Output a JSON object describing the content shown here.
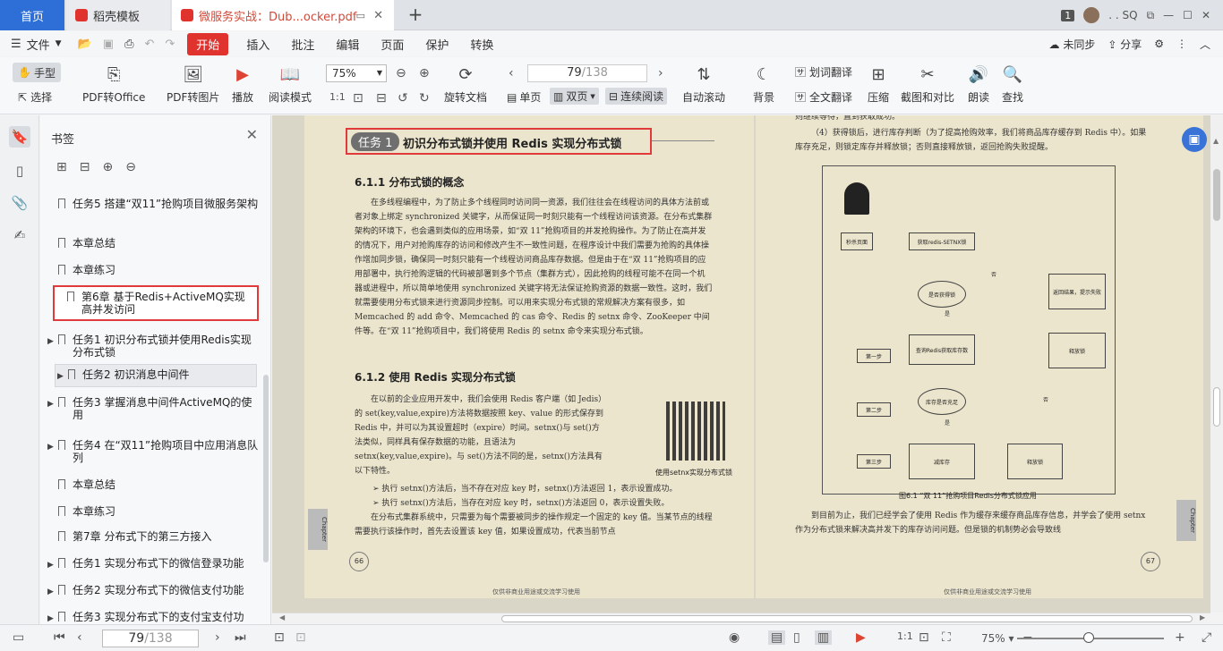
{
  "tabs": {
    "home": "首页",
    "daoke": "稻壳模板",
    "document": "微服务实战：Dub...ocker.pdf"
  },
  "titlebar": {
    "badge": "1",
    "user": ". . SQ"
  },
  "menu": {
    "file": "文件",
    "items": [
      "开始",
      "插入",
      "批注",
      "编辑",
      "页面",
      "保护",
      "转换"
    ],
    "sync": "未同步",
    "share": "分享"
  },
  "toolbar": {
    "hand": "手型",
    "select": "选择",
    "pdf_office": "PDF转Office",
    "pdf_image": "PDF转图片",
    "play": "播放",
    "read_mode": "阅读模式",
    "zoom": "75%",
    "rotate": "旋转文档",
    "single": "单页",
    "double": "双页",
    "continuous": "连续阅读",
    "autoscroll": "自动滚动",
    "background": "背景",
    "word_translate": "划词翻译",
    "full_translate": "全文翻译",
    "compress": "压缩",
    "screenshot": "截图和对比",
    "read_aloud": "朗读",
    "find": "查找",
    "page_current": "79",
    "page_total": "/138"
  },
  "sidebar": {
    "title": "书签",
    "bookmarks": [
      {
        "text": "任务5 搭建“双11”抢购项目微服务架构",
        "arrow": false
      },
      {
        "text": "本章总结",
        "arrow": false
      },
      {
        "text": "本章练习",
        "arrow": false
      },
      {
        "text": "第6章 基于Redis+ActiveMQ实现高并发访问",
        "arrow": false
      },
      {
        "text": "任务1 初识分布式锁并使用Redis实现分布式锁",
        "arrow": true
      },
      {
        "text": "任务2 初识消息中间件",
        "arrow": true
      },
      {
        "text": "任务3 掌握消息中间件ActiveMQ的使用",
        "arrow": true
      },
      {
        "text": "任务4 在“双11”抢购项目中应用消息队列",
        "arrow": true
      },
      {
        "text": "本章总结",
        "arrow": false
      },
      {
        "text": "本章练习",
        "arrow": false
      },
      {
        "text": "第7章 分布式下的第三方接入",
        "arrow": false
      },
      {
        "text": "任务1 实现分布式下的微信登录功能",
        "arrow": true
      },
      {
        "text": "任务2 实现分布式下的微信支付功能",
        "arrow": true
      },
      {
        "text": "任务3 实现分布式下的支付宝支付功",
        "arrow": true
      }
    ]
  },
  "page_left": {
    "task_pill": "任务 1",
    "task_title": "初识分布式锁并使用 Redis 实现分布式锁",
    "sec1": "6.1.1 分布式锁的概念",
    "para1": "在多线程编程中，为了防止多个线程同时访问同一资源，我们往往会在线程访问的具体方法前或者对象上绑定 synchronized 关键字，从而保证同一时刻只能有一个线程访问该资源。在分布式集群架构的环境下，也会遇到类似的应用场景，如“双 11”抢购项目的并发抢购操作。为了防止在高并发的情况下，用户对抢购库存的访问和修改产生不一致性问题，在程序设计中我们需要为抢购的具体操作增加同步锁，确保同一时刻只能有一个线程访问商品库存数据。但是由于在“双 11”抢购项目的应用部署中，执行抢购逻辑的代码被部署到多个节点（集群方式），因此抢购的线程可能不在同一个机器或进程中，所以简单地使用 synchronized 关键字将无法保证抢购资源的数据一致性。这时，我们就需要使用分布式锁来进行资源同步控制。可以用来实现分布式锁的常规解决方案有很多，如 Memcached 的 add 命令、Memcached 的 cas 命令、Redis 的 setnx 命令、ZooKeeper 中间件等。在“双 11”抢购项目中，我们将使用 Redis 的 setnx 命令来实现分布式锁。",
    "sec2": "6.1.2 使用 Redis 实现分布式锁",
    "para2": "在以前的企业应用开发中，我们会使用 Redis 客户端（如 Jedis）的 set(key,value,expire)方法将数据按照 key、value 的形式保存到 Redis 中，并可以为其设置超时（expire）时间。setnx()与 set()方法类似，同样具有保存数据的功能，且语法为 setnx(key,value,expire)。与 set()方法不同的是，setnx()方法具有以下特性。",
    "bullet1": "➢ 执行 setnx()方法后，当不存在对应 key 时，setnx()方法返回 1，表示设置成功。",
    "bullet2": "➢ 执行 setnx()方法后，当存在对应 key 时，setnx()方法返回 0，表示设置失败。",
    "para3": "在分布式集群系统中，只需要为每个需要被同步的操作规定一个固定的 key 值。当某节点的线程需要执行该操作时，首先去设置该 key 值，如果设置成功，代表当前节点",
    "qr_caption": "使用setnx实现分布式锁",
    "page_num": "66",
    "footer": "仅供非商业用途或交流学习使用",
    "chapter": "Chapter"
  },
  "page_right": {
    "top1": "则继续等待，直到获取成功。",
    "top2": "（4）获得锁后，进行库存判断（为了提高抢购效率，我们将商品库存缓存到 Redis 中）。如果库存充足，则锁定库存并释放锁；否则直接释放锁，返回抢购失败提醒。",
    "flow": {
      "seckill": "秒杀页面",
      "getlock": "获取redis-SETNX锁",
      "success": "是否获得锁",
      "yes": "是",
      "no": "否",
      "query": "查询Redis获取库存数",
      "enough": "库存是否充足",
      "reduce": "减库存",
      "release1": "释放锁",
      "release2": "释放锁",
      "fail": "返回结果，提示失败",
      "step1": "第一步",
      "step2": "第二步",
      "step3": "第三步"
    },
    "fig_caption": "图6.1 “双 11”抢购项目Redis分布式锁应用",
    "bottom": "到目前为止，我们已经学会了使用 Redis 作为缓存来缓存商品库存信息，并学会了使用 setnx 作为分布式锁来解决高并发下的库存访问问题。但是锁的机制势必会导致线",
    "page_num": "67",
    "footer": "仅供非商业用途或交流学习使用",
    "chapter": "Chapter"
  },
  "statusbar": {
    "page_current": "79",
    "page_total": "/138",
    "zoom": "75%"
  },
  "colors": {
    "accent_red": "#e0332d",
    "tab_blue": "#2d6fd6",
    "page_bg": "#ece5cd"
  }
}
